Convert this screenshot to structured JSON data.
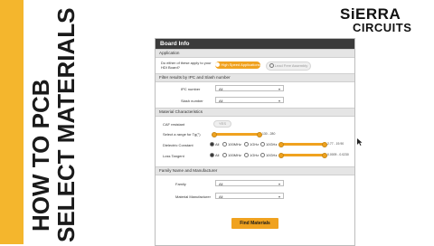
{
  "side": {
    "line1": "HOW TO PCB",
    "line2": "SELECT MATERIALS",
    "bar_color": "#f4b62d"
  },
  "logo": {
    "top": "SiERRA",
    "bottom": "CIRCUITS"
  },
  "panel": {
    "title": "Board Info",
    "application": {
      "header": "Application",
      "question": "Do either of these apply to your HDI Board?",
      "option_selected": "High Speed Applications",
      "option_other": "Lead Free Assembly"
    },
    "filter": {
      "header": "Filter results by IPC and Slash number",
      "ipc_label": "IPC number",
      "ipc_value": "All",
      "slash_label": "Slash number",
      "slash_value": "All"
    },
    "material": {
      "header": "Material Characteristics",
      "caf_label": "CAF resistant",
      "caf_value": "YES",
      "tg_label": "Select a range for Tg(°)",
      "tg_range": "130 - 280",
      "dk_label": "Dielectric Constant",
      "dk_options": [
        "All",
        "100MHz",
        "1GHz",
        "10GHz"
      ],
      "dk_range": "2.77 - 19.90",
      "lt_label": "Loss Tangent",
      "lt_options": [
        "All",
        "100MHz",
        "1GHz",
        "10GHz"
      ],
      "lt_range": "0.0009 - 0.0230"
    },
    "family": {
      "header": "Family Name and Manufacturer",
      "family_label": "Family",
      "family_value": "All",
      "mfr_label": "Material Manufacturer",
      "mfr_value": "All"
    },
    "find_button": "Find Materials"
  },
  "colors": {
    "accent": "#f0a21f",
    "header": "#3b3b3b"
  }
}
